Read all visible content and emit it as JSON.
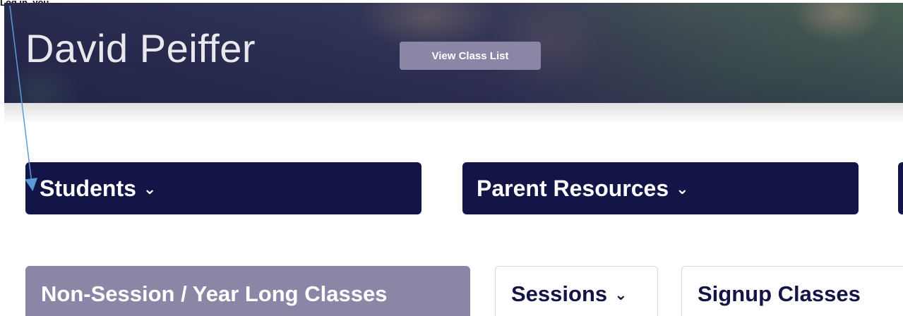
{
  "annotation": {
    "caption": "Log in, you",
    "arrow_color": "#5b9bd5",
    "target": "students-button"
  },
  "header": {
    "teacher_name": "David Peiffer",
    "view_class_list_label": "View Class List"
  },
  "nav": {
    "students_label": "Students",
    "parent_resources_label": "Parent Resources",
    "caret": "⌄"
  },
  "tabs": [
    {
      "label": "Non-Session / Year Long Classes",
      "active": true
    },
    {
      "label": "Sessions",
      "has_caret": true
    },
    {
      "label": "Signup Classes"
    }
  ],
  "colors": {
    "navy": "#131546",
    "lavender": "#8b86a6"
  }
}
